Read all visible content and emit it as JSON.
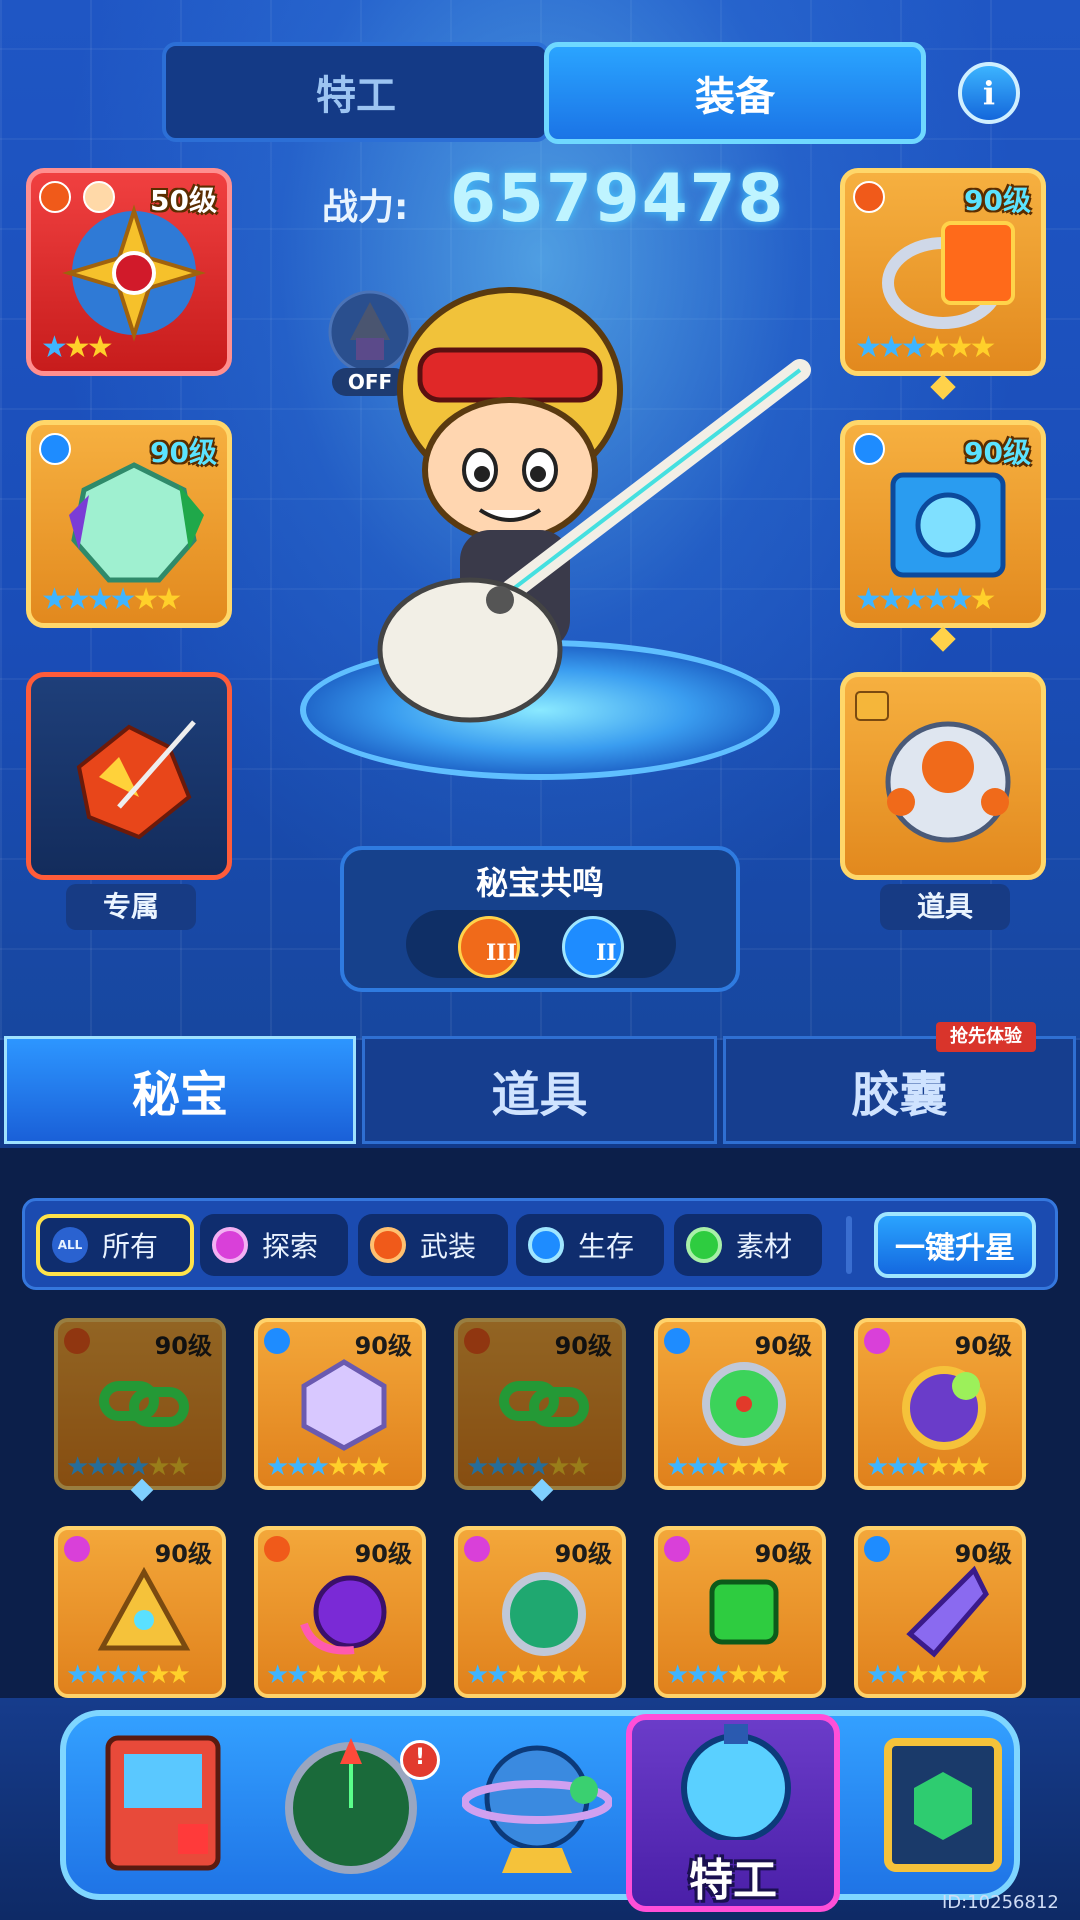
{
  "top_tabs": {
    "agent": "特工",
    "equipment": "装备"
  },
  "power": {
    "label": "战力:",
    "value": "6579478"
  },
  "drill_toggle": "OFF",
  "slots": {
    "left": [
      {
        "level": "50级",
        "stars": 3,
        "blue_stars": 1,
        "color": "#e23a3a"
      },
      {
        "level": "90级",
        "stars": 6,
        "blue_stars": 4,
        "color": "#f0a030"
      },
      {
        "label": "专属"
      }
    ],
    "right": [
      {
        "level": "90级",
        "stars": 6,
        "blue_stars": 3,
        "color": "#f0a030"
      },
      {
        "level": "90级",
        "stars": 6,
        "blue_stars": 5,
        "color": "#f0a030"
      },
      {
        "label": "道具"
      }
    ]
  },
  "resonance": {
    "title": "秘宝共鸣",
    "levels": [
      "III",
      "II"
    ]
  },
  "bottom_tabs": {
    "treasure": "秘宝",
    "item": "道具",
    "capsule": "胶囊",
    "early_badge": "抢先体验"
  },
  "filters": {
    "all_icon": "ALL",
    "all": "所有",
    "explore": "探索",
    "arms": "武装",
    "survive": "生存",
    "material": "素材",
    "star_up": "一键升星"
  },
  "inventory": [
    {
      "level": "90级",
      "blue_stars": 4,
      "type": "arms",
      "locked_link": true
    },
    {
      "level": "90级",
      "blue_stars": 3,
      "type": "survive",
      "locked_link": false
    },
    {
      "level": "90级",
      "blue_stars": 4,
      "type": "arms",
      "locked_link": true
    },
    {
      "level": "90级",
      "blue_stars": 3,
      "type": "survive",
      "locked_link": false
    },
    {
      "level": "90级",
      "blue_stars": 3,
      "type": "explore",
      "locked_link": false
    },
    {
      "level": "90级",
      "blue_stars": 4,
      "type": "explore",
      "locked_link": false
    },
    {
      "level": "90级",
      "blue_stars": 2,
      "type": "arms",
      "locked_link": false
    },
    {
      "level": "90级",
      "blue_stars": 2,
      "type": "explore",
      "locked_link": false
    },
    {
      "level": "90级",
      "blue_stars": 3,
      "type": "explore",
      "locked_link": false
    },
    {
      "level": "90级",
      "blue_stars": 2,
      "type": "survive",
      "locked_link": false
    }
  ],
  "nav": {
    "agent_label": "特工",
    "alert": "!"
  },
  "user_id": "ID:10256812",
  "colors": {
    "explore": "#d940d9",
    "arms": "#f05a1a",
    "survive": "#1e8cff",
    "material": "#2ecc40"
  }
}
